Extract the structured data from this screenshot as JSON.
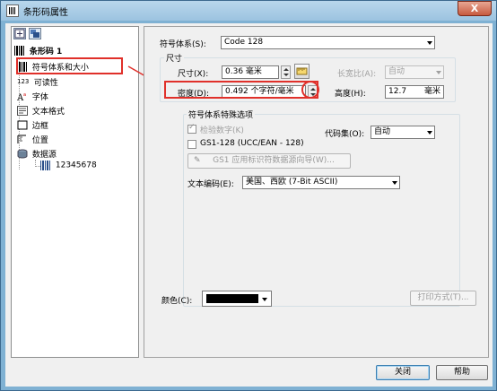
{
  "window": {
    "title": "条形码属性",
    "close_label": "X"
  },
  "tree": {
    "root_label": "条形码 1",
    "items": [
      {
        "label": "符号体系和大小",
        "icon": "barcode-icon"
      },
      {
        "label": "可读性",
        "icon": "readability-123-icon"
      },
      {
        "label": "字体",
        "icon": "font-icon"
      },
      {
        "label": "文本格式",
        "icon": "text-format-icon"
      },
      {
        "label": "边框",
        "icon": "border-icon"
      },
      {
        "label": "位置",
        "icon": "position-icon"
      },
      {
        "label": "数据源",
        "icon": "database-icon"
      }
    ],
    "data_source_child": {
      "label": "12345678",
      "icon": "barcode-data-icon"
    }
  },
  "readability_prefix": "123",
  "symbology": {
    "label": "符号体系(S):",
    "value": "Code 128"
  },
  "size_group": {
    "title": "尺寸",
    "size_label": "尺寸(X):",
    "size_value": "0.36 毫米",
    "aspect_label": "长宽比(A):",
    "aspect_value": "自动",
    "density_label": "密度(D):",
    "density_value": "0.492  个字符/毫米",
    "height_label": "高度(H):",
    "height_value": "12.7",
    "height_unit": "毫米"
  },
  "special_options": {
    "title": "符号体系特殊选项",
    "check_digit_label": "检验数字(K)",
    "check_digit_checked": true,
    "gs1_label": "GS1-128 (UCC/EAN - 128)",
    "gs1_checked": false,
    "code_set_label": "代码集(O):",
    "code_set_value": "自动",
    "gs1_wizard_label": "GS1 应用标识符数据源向导(W)...",
    "text_encoding_label": "文本编码(E):",
    "text_encoding_value": "美国、西欧 (7-Bit ASCII)"
  },
  "color": {
    "label": "颜色(C):",
    "value": "#000000"
  },
  "print_method_label": "打印方式(T)...",
  "footer": {
    "close_label": "关闭",
    "help_label": "帮助"
  },
  "colors": {
    "accent": "#e0302a",
    "title_bar": "#9cc3e0"
  }
}
